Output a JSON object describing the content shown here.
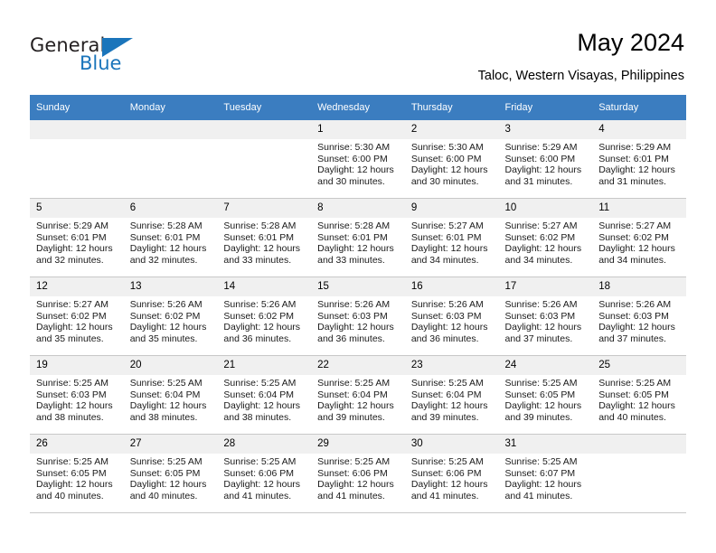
{
  "brand": {
    "name_part1": "General",
    "name_part2": "Blue",
    "accent_color": "#1b75bb",
    "triangle_icon": "logo-triangle-icon"
  },
  "header": {
    "title": "May 2024",
    "subtitle": "Taloc, Western Visayas, Philippines"
  },
  "calendar": {
    "header_bg": "#3b7dc0",
    "daynum_bg": "#f0f0f0",
    "weekday_headers": [
      "Sunday",
      "Monday",
      "Tuesday",
      "Wednesday",
      "Thursday",
      "Friday",
      "Saturday"
    ],
    "weeks": [
      [
        {
          "day": "",
          "sunrise": "",
          "sunset": "",
          "daylight_line1": "",
          "daylight_line2": ""
        },
        {
          "day": "",
          "sunrise": "",
          "sunset": "",
          "daylight_line1": "",
          "daylight_line2": ""
        },
        {
          "day": "",
          "sunrise": "",
          "sunset": "",
          "daylight_line1": "",
          "daylight_line2": ""
        },
        {
          "day": "1",
          "sunrise": "Sunrise: 5:30 AM",
          "sunset": "Sunset: 6:00 PM",
          "daylight_line1": "Daylight: 12 hours",
          "daylight_line2": "and 30 minutes."
        },
        {
          "day": "2",
          "sunrise": "Sunrise: 5:30 AM",
          "sunset": "Sunset: 6:00 PM",
          "daylight_line1": "Daylight: 12 hours",
          "daylight_line2": "and 30 minutes."
        },
        {
          "day": "3",
          "sunrise": "Sunrise: 5:29 AM",
          "sunset": "Sunset: 6:00 PM",
          "daylight_line1": "Daylight: 12 hours",
          "daylight_line2": "and 31 minutes."
        },
        {
          "day": "4",
          "sunrise": "Sunrise: 5:29 AM",
          "sunset": "Sunset: 6:01 PM",
          "daylight_line1": "Daylight: 12 hours",
          "daylight_line2": "and 31 minutes."
        }
      ],
      [
        {
          "day": "5",
          "sunrise": "Sunrise: 5:29 AM",
          "sunset": "Sunset: 6:01 PM",
          "daylight_line1": "Daylight: 12 hours",
          "daylight_line2": "and 32 minutes."
        },
        {
          "day": "6",
          "sunrise": "Sunrise: 5:28 AM",
          "sunset": "Sunset: 6:01 PM",
          "daylight_line1": "Daylight: 12 hours",
          "daylight_line2": "and 32 minutes."
        },
        {
          "day": "7",
          "sunrise": "Sunrise: 5:28 AM",
          "sunset": "Sunset: 6:01 PM",
          "daylight_line1": "Daylight: 12 hours",
          "daylight_line2": "and 33 minutes."
        },
        {
          "day": "8",
          "sunrise": "Sunrise: 5:28 AM",
          "sunset": "Sunset: 6:01 PM",
          "daylight_line1": "Daylight: 12 hours",
          "daylight_line2": "and 33 minutes."
        },
        {
          "day": "9",
          "sunrise": "Sunrise: 5:27 AM",
          "sunset": "Sunset: 6:01 PM",
          "daylight_line1": "Daylight: 12 hours",
          "daylight_line2": "and 34 minutes."
        },
        {
          "day": "10",
          "sunrise": "Sunrise: 5:27 AM",
          "sunset": "Sunset: 6:02 PM",
          "daylight_line1": "Daylight: 12 hours",
          "daylight_line2": "and 34 minutes."
        },
        {
          "day": "11",
          "sunrise": "Sunrise: 5:27 AM",
          "sunset": "Sunset: 6:02 PM",
          "daylight_line1": "Daylight: 12 hours",
          "daylight_line2": "and 34 minutes."
        }
      ],
      [
        {
          "day": "12",
          "sunrise": "Sunrise: 5:27 AM",
          "sunset": "Sunset: 6:02 PM",
          "daylight_line1": "Daylight: 12 hours",
          "daylight_line2": "and 35 minutes."
        },
        {
          "day": "13",
          "sunrise": "Sunrise: 5:26 AM",
          "sunset": "Sunset: 6:02 PM",
          "daylight_line1": "Daylight: 12 hours",
          "daylight_line2": "and 35 minutes."
        },
        {
          "day": "14",
          "sunrise": "Sunrise: 5:26 AM",
          "sunset": "Sunset: 6:02 PM",
          "daylight_line1": "Daylight: 12 hours",
          "daylight_line2": "and 36 minutes."
        },
        {
          "day": "15",
          "sunrise": "Sunrise: 5:26 AM",
          "sunset": "Sunset: 6:03 PM",
          "daylight_line1": "Daylight: 12 hours",
          "daylight_line2": "and 36 minutes."
        },
        {
          "day": "16",
          "sunrise": "Sunrise: 5:26 AM",
          "sunset": "Sunset: 6:03 PM",
          "daylight_line1": "Daylight: 12 hours",
          "daylight_line2": "and 36 minutes."
        },
        {
          "day": "17",
          "sunrise": "Sunrise: 5:26 AM",
          "sunset": "Sunset: 6:03 PM",
          "daylight_line1": "Daylight: 12 hours",
          "daylight_line2": "and 37 minutes."
        },
        {
          "day": "18",
          "sunrise": "Sunrise: 5:26 AM",
          "sunset": "Sunset: 6:03 PM",
          "daylight_line1": "Daylight: 12 hours",
          "daylight_line2": "and 37 minutes."
        }
      ],
      [
        {
          "day": "19",
          "sunrise": "Sunrise: 5:25 AM",
          "sunset": "Sunset: 6:03 PM",
          "daylight_line1": "Daylight: 12 hours",
          "daylight_line2": "and 38 minutes."
        },
        {
          "day": "20",
          "sunrise": "Sunrise: 5:25 AM",
          "sunset": "Sunset: 6:04 PM",
          "daylight_line1": "Daylight: 12 hours",
          "daylight_line2": "and 38 minutes."
        },
        {
          "day": "21",
          "sunrise": "Sunrise: 5:25 AM",
          "sunset": "Sunset: 6:04 PM",
          "daylight_line1": "Daylight: 12 hours",
          "daylight_line2": "and 38 minutes."
        },
        {
          "day": "22",
          "sunrise": "Sunrise: 5:25 AM",
          "sunset": "Sunset: 6:04 PM",
          "daylight_line1": "Daylight: 12 hours",
          "daylight_line2": "and 39 minutes."
        },
        {
          "day": "23",
          "sunrise": "Sunrise: 5:25 AM",
          "sunset": "Sunset: 6:04 PM",
          "daylight_line1": "Daylight: 12 hours",
          "daylight_line2": "and 39 minutes."
        },
        {
          "day": "24",
          "sunrise": "Sunrise: 5:25 AM",
          "sunset": "Sunset: 6:05 PM",
          "daylight_line1": "Daylight: 12 hours",
          "daylight_line2": "and 39 minutes."
        },
        {
          "day": "25",
          "sunrise": "Sunrise: 5:25 AM",
          "sunset": "Sunset: 6:05 PM",
          "daylight_line1": "Daylight: 12 hours",
          "daylight_line2": "and 40 minutes."
        }
      ],
      [
        {
          "day": "26",
          "sunrise": "Sunrise: 5:25 AM",
          "sunset": "Sunset: 6:05 PM",
          "daylight_line1": "Daylight: 12 hours",
          "daylight_line2": "and 40 minutes."
        },
        {
          "day": "27",
          "sunrise": "Sunrise: 5:25 AM",
          "sunset": "Sunset: 6:05 PM",
          "daylight_line1": "Daylight: 12 hours",
          "daylight_line2": "and 40 minutes."
        },
        {
          "day": "28",
          "sunrise": "Sunrise: 5:25 AM",
          "sunset": "Sunset: 6:06 PM",
          "daylight_line1": "Daylight: 12 hours",
          "daylight_line2": "and 41 minutes."
        },
        {
          "day": "29",
          "sunrise": "Sunrise: 5:25 AM",
          "sunset": "Sunset: 6:06 PM",
          "daylight_line1": "Daylight: 12 hours",
          "daylight_line2": "and 41 minutes."
        },
        {
          "day": "30",
          "sunrise": "Sunrise: 5:25 AM",
          "sunset": "Sunset: 6:06 PM",
          "daylight_line1": "Daylight: 12 hours",
          "daylight_line2": "and 41 minutes."
        },
        {
          "day": "31",
          "sunrise": "Sunrise: 5:25 AM",
          "sunset": "Sunset: 6:07 PM",
          "daylight_line1": "Daylight: 12 hours",
          "daylight_line2": "and 41 minutes."
        },
        {
          "day": "",
          "sunrise": "",
          "sunset": "",
          "daylight_line1": "",
          "daylight_line2": ""
        }
      ]
    ]
  }
}
